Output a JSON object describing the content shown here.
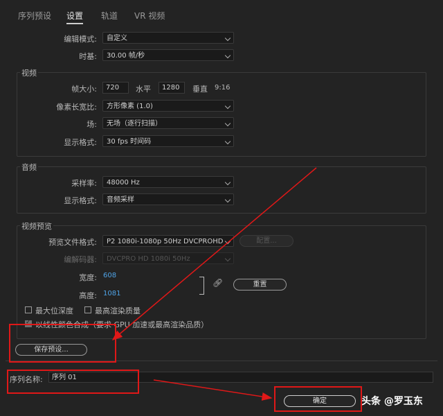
{
  "tabs": [
    "序列预设",
    "设置",
    "轨道",
    "VR 视频"
  ],
  "general": {
    "edit_mode_label": "编辑模式:",
    "edit_mode_value": "自定义",
    "timebase_label": "时基:",
    "timebase_value": "30.00  帧/秒"
  },
  "video": {
    "title": "视频",
    "frame_size_label": "帧大小:",
    "frame_width": "720",
    "horizontal_label": "水平",
    "frame_height": "1280",
    "vertical_label": "垂直",
    "aspect": "9:16",
    "pixel_aspect_label": "像素长宽比:",
    "pixel_aspect_value": "方形像素 (1.0)",
    "fields_label": "场:",
    "fields_value": "无场（逐行扫描）",
    "display_format_label": "显示格式:",
    "display_format_value": "30 fps 时间码"
  },
  "audio": {
    "title": "音频",
    "sample_rate_label": "采样率:",
    "sample_rate_value": "48000 Hz",
    "display_format_label": "显示格式:",
    "display_format_value": "音频采样"
  },
  "preview": {
    "title": "视频预览",
    "file_format_label": "预览文件格式:",
    "file_format_value": "P2 1080i-1080p 50Hz DVCPROHD",
    "configure_label": "配置...",
    "codec_label": "编解码器:",
    "codec_value": "DVCPRO HD 1080i 50Hz",
    "width_label": "宽度:",
    "width_value": "608",
    "height_label": "高度:",
    "height_value": "1081",
    "reset_label": "重置",
    "max_bit_depth": "最大位深度",
    "max_render_quality": "最高渲染质量",
    "linear_color": "以线性颜色合成（要求 GPU 加速或最高渲染品质）"
  },
  "save_preset_label": "保存预设...",
  "sequence_name_label": "序列名称:",
  "sequence_name_value": "序列 01",
  "ok_label": "确定",
  "watermark": "头条 @罗玉东",
  "colors": {
    "annotation": "#e01818",
    "link_blue": "#4fa3e6"
  }
}
